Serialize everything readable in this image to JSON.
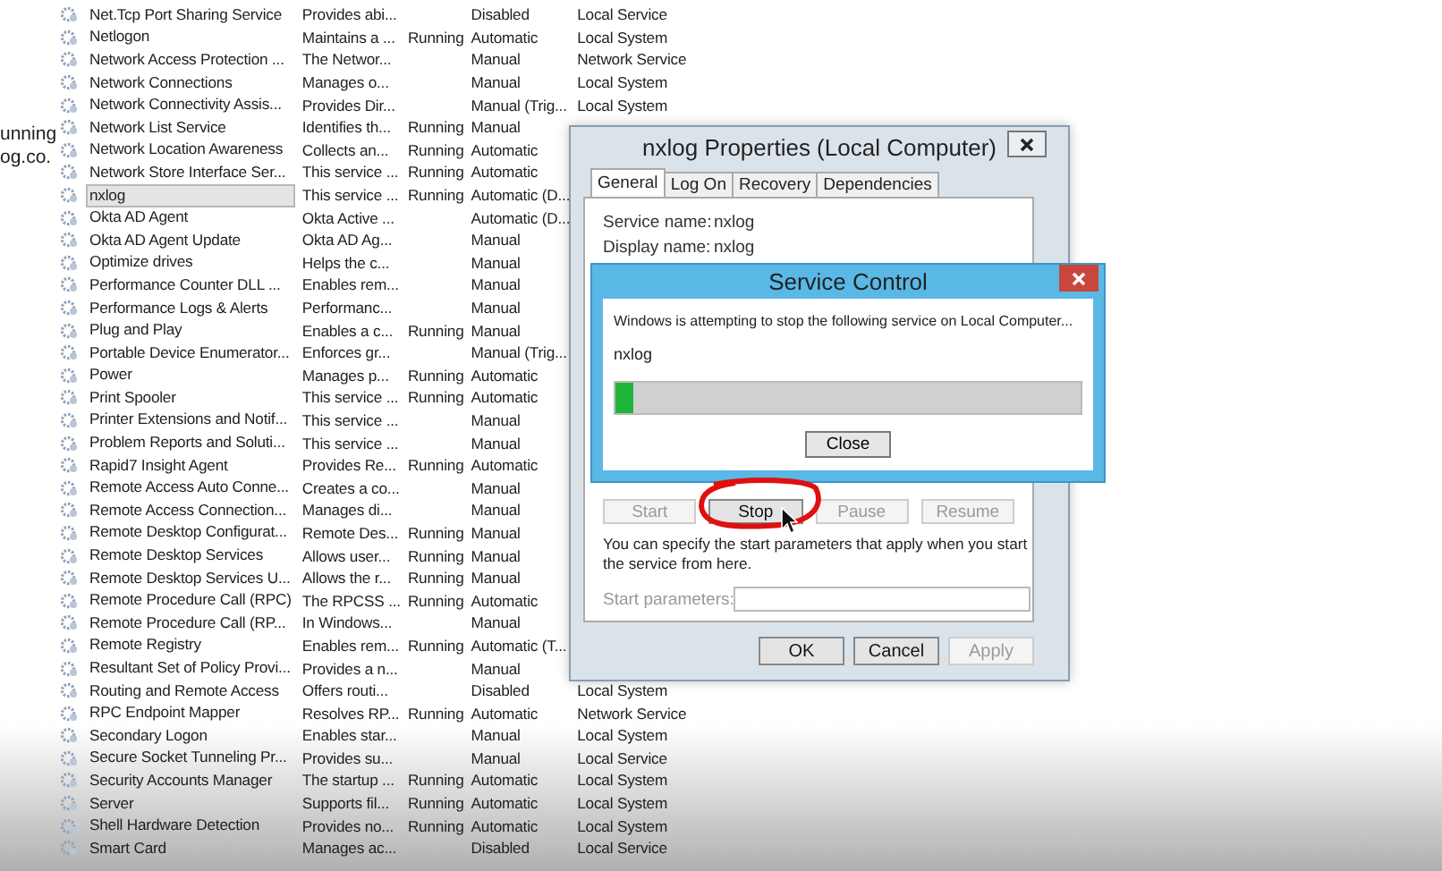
{
  "side_fragment": [
    "unning",
    "og.co."
  ],
  "services": {
    "rows": [
      {
        "name": "Net.Tcp Port Sharing Service",
        "description": "Provides abi...",
        "status": "",
        "startup_type": "Disabled",
        "log_on_as": "Local Service",
        "selected": false
      },
      {
        "name": "Netlogon",
        "description": "Maintains a ...",
        "status": "Running",
        "startup_type": "Automatic",
        "log_on_as": "Local System",
        "selected": false
      },
      {
        "name": "Network Access Protection ...",
        "description": "The Networ...",
        "status": "",
        "startup_type": "Manual",
        "log_on_as": "Network Service",
        "selected": false
      },
      {
        "name": "Network Connections",
        "description": "Manages o...",
        "status": "",
        "startup_type": "Manual",
        "log_on_as": "Local System",
        "selected": false
      },
      {
        "name": "Network Connectivity Assis...",
        "description": "Provides Dir...",
        "status": "",
        "startup_type": "Manual (Trig...",
        "log_on_as": "Local System",
        "selected": false
      },
      {
        "name": "Network List Service",
        "description": "Identifies th...",
        "status": "Running",
        "startup_type": "Manual",
        "selected": false
      },
      {
        "name": "Network Location Awareness",
        "description": "Collects an...",
        "status": "Running",
        "startup_type": "Automatic",
        "selected": false
      },
      {
        "name": "Network Store Interface Ser...",
        "description": "This service ...",
        "status": "Running",
        "startup_type": "Automatic",
        "selected": false
      },
      {
        "name": "nxlog",
        "description": "This service ...",
        "status": "Running",
        "startup_type": "Automatic (D...",
        "selected": true
      },
      {
        "name": "Okta AD Agent",
        "description": "Okta Active ...",
        "status": "",
        "startup_type": "Automatic (D...",
        "selected": false
      },
      {
        "name": "Okta AD Agent Update",
        "description": "Okta AD Ag...",
        "status": "",
        "startup_type": "Manual",
        "selected": false
      },
      {
        "name": "Optimize drives",
        "description": "Helps the c...",
        "status": "",
        "startup_type": "Manual",
        "selected": false
      },
      {
        "name": "Performance Counter DLL ...",
        "description": "Enables rem...",
        "status": "",
        "startup_type": "Manual",
        "selected": false
      },
      {
        "name": "Performance Logs & Alerts",
        "description": "Performanc...",
        "status": "",
        "startup_type": "Manual",
        "selected": false
      },
      {
        "name": "Plug and Play",
        "description": "Enables a c...",
        "status": "Running",
        "startup_type": "Manual",
        "selected": false
      },
      {
        "name": "Portable Device Enumerator...",
        "description": "Enforces gr...",
        "status": "",
        "startup_type": "Manual (Trig...",
        "selected": false
      },
      {
        "name": "Power",
        "description": "Manages p...",
        "status": "Running",
        "startup_type": "Automatic",
        "selected": false
      },
      {
        "name": "Print Spooler",
        "description": "This service ...",
        "status": "Running",
        "startup_type": "Automatic",
        "selected": false
      },
      {
        "name": "Printer Extensions and Notif...",
        "description": "This service ...",
        "status": "",
        "startup_type": "Manual",
        "selected": false
      },
      {
        "name": "Problem Reports and Soluti...",
        "description": "This service ...",
        "status": "",
        "startup_type": "Manual",
        "selected": false
      },
      {
        "name": "Rapid7 Insight Agent",
        "description": "Provides Re...",
        "status": "Running",
        "startup_type": "Automatic",
        "selected": false
      },
      {
        "name": "Remote Access Auto Conne...",
        "description": "Creates a co...",
        "status": "",
        "startup_type": "Manual",
        "selected": false
      },
      {
        "name": "Remote Access Connection...",
        "description": "Manages di...",
        "status": "",
        "startup_type": "Manual",
        "selected": false
      },
      {
        "name": "Remote Desktop Configurat...",
        "description": "Remote Des...",
        "status": "Running",
        "startup_type": "Manual",
        "selected": false
      },
      {
        "name": "Remote Desktop Services",
        "description": "Allows user...",
        "status": "Running",
        "startup_type": "Manual",
        "selected": false
      },
      {
        "name": "Remote Desktop Services U...",
        "description": "Allows the r...",
        "status": "Running",
        "startup_type": "Manual",
        "selected": false
      },
      {
        "name": "Remote Procedure Call (RPC)",
        "description": "The RPCSS ...",
        "status": "Running",
        "startup_type": "Automatic",
        "selected": false
      },
      {
        "name": "Remote Procedure Call (RP...",
        "description": "In Windows...",
        "status": "",
        "startup_type": "Manual",
        "selected": false
      },
      {
        "name": "Remote Registry",
        "description": "Enables rem...",
        "status": "Running",
        "startup_type": "Automatic (T...",
        "selected": false
      },
      {
        "name": "Resultant Set of Policy Provi...",
        "description": "Provides a n...",
        "status": "",
        "startup_type": "Manual",
        "selected": false
      },
      {
        "name": "Routing and Remote Access",
        "description": "Offers routi...",
        "status": "",
        "startup_type": "Disabled",
        "log_on_as": "Local System",
        "selected": false
      },
      {
        "name": "RPC Endpoint Mapper",
        "description": "Resolves RP...",
        "status": "Running",
        "startup_type": "Automatic",
        "log_on_as": "Network Service",
        "selected": false
      },
      {
        "name": "Secondary Logon",
        "description": "Enables star...",
        "status": "",
        "startup_type": "Manual",
        "log_on_as": "Local System",
        "selected": false
      },
      {
        "name": "Secure Socket Tunneling Pr...",
        "description": "Provides su...",
        "status": "",
        "startup_type": "Manual",
        "log_on_as": "Local Service",
        "selected": false
      },
      {
        "name": "Security Accounts Manager",
        "description": "The startup ...",
        "status": "Running",
        "startup_type": "Automatic",
        "log_on_as": "Local System",
        "selected": false
      },
      {
        "name": "Server",
        "description": "Supports fil...",
        "status": "Running",
        "startup_type": "Automatic",
        "log_on_as": "Local System",
        "selected": false
      },
      {
        "name": "Shell Hardware Detection",
        "description": "Provides no...",
        "status": "Running",
        "startup_type": "Automatic",
        "log_on_as": "Local System",
        "selected": false
      },
      {
        "name": "Smart Card",
        "description": "Manages ac...",
        "status": "",
        "startup_type": "Disabled",
        "log_on_as": "Local Service",
        "selected": false
      }
    ]
  },
  "properties_dialog": {
    "title": "nxlog Properties (Local Computer)",
    "tabs": [
      {
        "label": "General",
        "selected": true
      },
      {
        "label": "Log On",
        "selected": false
      },
      {
        "label": "Recovery",
        "selected": false
      },
      {
        "label": "Dependencies",
        "selected": false
      }
    ],
    "fields": [
      {
        "label": "Service name:",
        "value": "nxlog"
      },
      {
        "label": "Display name:",
        "value": "nxlog"
      }
    ],
    "control_buttons": [
      {
        "label": "Start",
        "disabled": true
      },
      {
        "label": "Stop",
        "disabled": false
      },
      {
        "label": "Pause",
        "disabled": true
      },
      {
        "label": "Resume",
        "disabled": true
      }
    ],
    "hint": "You can specify the start parameters that apply when you start the service from here.",
    "start_parameters": {
      "label": "Start parameters:",
      "disabled": true
    },
    "buttons": [
      {
        "label": "OK",
        "disabled": false
      },
      {
        "label": "Cancel",
        "disabled": false
      },
      {
        "label": "Apply",
        "disabled": true
      }
    ]
  },
  "service_control": {
    "title": "Service Control",
    "message": "Windows is attempting to stop the following service on Local Computer...",
    "service": "nxlog",
    "progress": {
      "level": 0.04
    },
    "button": "Close"
  }
}
